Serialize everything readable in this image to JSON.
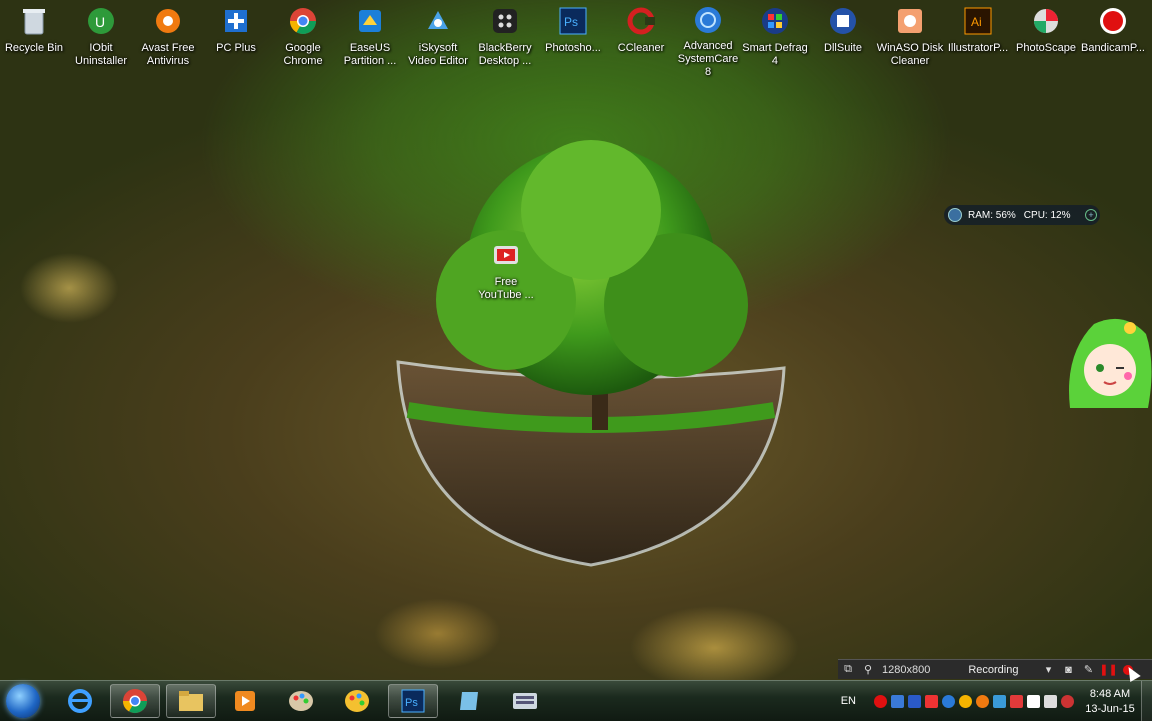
{
  "desktop_icons": [
    {
      "label": "Recycle Bin",
      "icon": "recycle-bin-icon"
    },
    {
      "label": "IObit\nUninstaller",
      "icon": "iobit-uninstaller-icon"
    },
    {
      "label": "Avast Free\nAntivirus",
      "icon": "avast-icon"
    },
    {
      "label": "PC Plus",
      "icon": "pc-plus-icon"
    },
    {
      "label": "Google\nChrome",
      "icon": "chrome-icon"
    },
    {
      "label": "EaseUS\nPartition ...",
      "icon": "easeus-icon"
    },
    {
      "label": "iSkysoft\nVideo Editor",
      "icon": "iskysoft-icon"
    },
    {
      "label": "BlackBerry\nDesktop ...",
      "icon": "blackberry-icon"
    },
    {
      "label": "Photosho...",
      "icon": "photoshop-icon"
    },
    {
      "label": "CCleaner",
      "icon": "ccleaner-icon"
    },
    {
      "label": "Advanced\nSystemCare 8",
      "icon": "advanced-systemcare-icon"
    },
    {
      "label": "Smart Defrag\n4",
      "icon": "smart-defrag-icon"
    },
    {
      "label": "DllSuite",
      "icon": "dllsuite-icon"
    },
    {
      "label": "WinASO Disk\nCleaner",
      "icon": "winaso-icon"
    },
    {
      "label": "IllustratorP...",
      "icon": "illustrator-icon"
    },
    {
      "label": "PhotoScape",
      "icon": "photoscape-icon"
    },
    {
      "label": "BandicamP...",
      "icon": "bandicam-icon"
    }
  ],
  "free_icon": {
    "label": "Free\nYouTube ...",
    "icon": "free-youtube-icon"
  },
  "widget": {
    "ram": "RAM: 56%",
    "cpu": "CPU: 12%"
  },
  "recorder": {
    "resolution": "1280x800",
    "status": "Recording"
  },
  "tray": {
    "lang": "EN"
  },
  "clock": {
    "time": "8:48 AM",
    "date": "13-Jun-15"
  },
  "colors": {
    "accent_red": "#e01010",
    "photoshop_blue": "#0a2a5c",
    "illustrator_orange": "#2a1400"
  }
}
